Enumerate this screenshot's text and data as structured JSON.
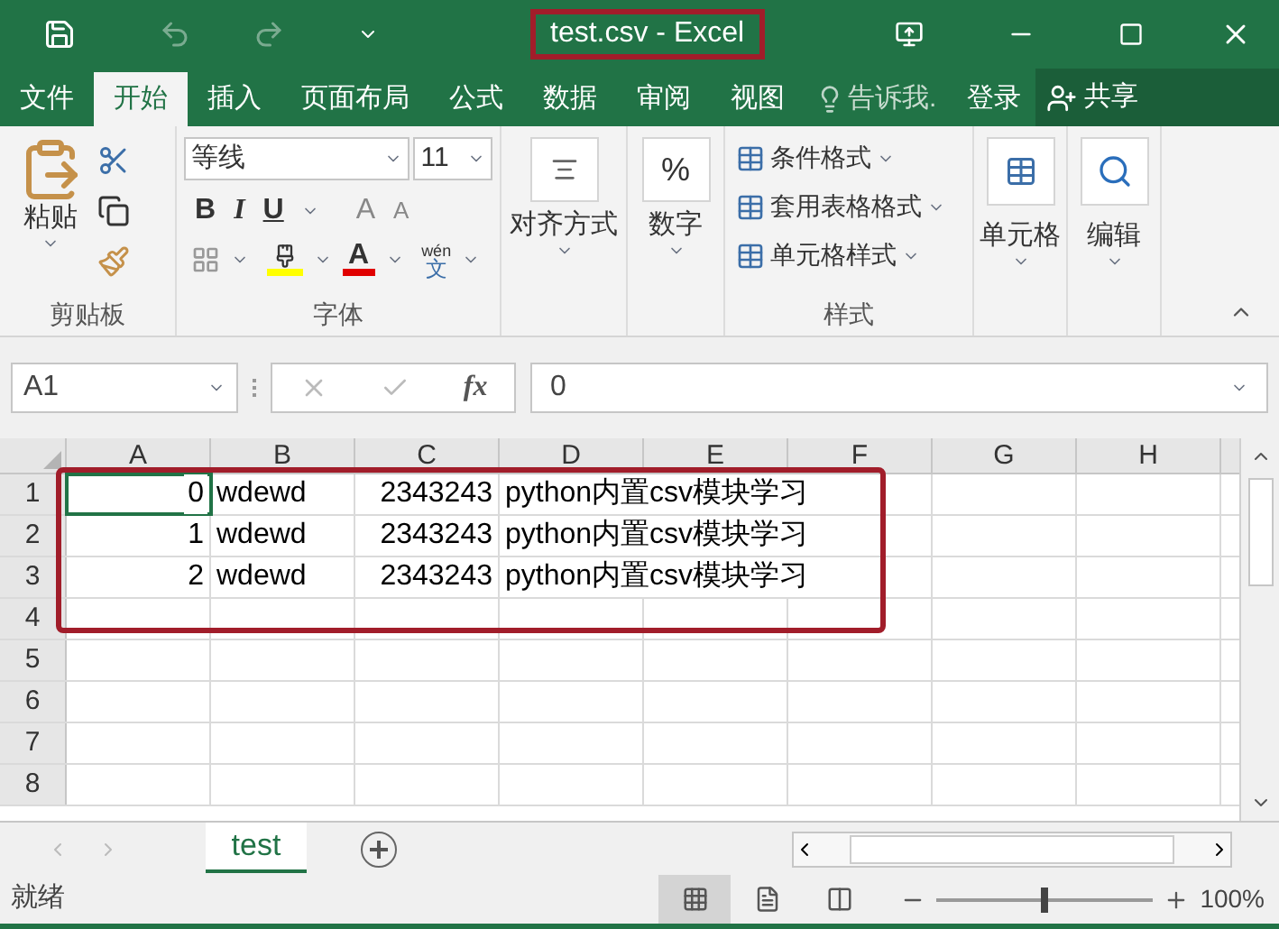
{
  "window": {
    "title": "test.csv - Excel"
  },
  "ribbon_tabs": [
    {
      "label": "文件",
      "selected": false
    },
    {
      "label": "开始",
      "selected": true
    },
    {
      "label": "插入",
      "selected": false
    },
    {
      "label": "页面布局",
      "selected": false
    },
    {
      "label": "公式",
      "selected": false
    },
    {
      "label": "数据",
      "selected": false
    },
    {
      "label": "审阅",
      "selected": false
    },
    {
      "label": "视图",
      "selected": false
    }
  ],
  "tell_me": {
    "placeholder": "告诉我."
  },
  "login": "登录",
  "share": "共享",
  "clipboard": {
    "paste": "粘贴",
    "group_label": "剪贴板"
  },
  "font": {
    "font_name": "等线",
    "font_size": "11",
    "bold": "B",
    "italic": "I",
    "underline": "U",
    "grow_font": "A",
    "shrink_font": "A",
    "font_color": "A",
    "phonetic": "wén",
    "phonetic_char": "文",
    "group_label": "字体"
  },
  "alignment": {
    "label": "对齐方式"
  },
  "number": {
    "symbol": "%",
    "label": "数字"
  },
  "styles": {
    "items": [
      "条件格式",
      "套用表格格式",
      "单元格样式"
    ],
    "group_label": "样式"
  },
  "cells": {
    "label": "单元格"
  },
  "editing": {
    "label": "编辑"
  },
  "name_box": {
    "value": "A1"
  },
  "formula_bar": {
    "fx": "fx",
    "value": "0"
  },
  "columns": [
    "A",
    "B",
    "C",
    "D",
    "E",
    "F",
    "G",
    "H"
  ],
  "row_numbers": [
    "1",
    "2",
    "3",
    "4",
    "5",
    "6",
    "7",
    "8"
  ],
  "rows": [
    {
      "cells": [
        {
          "value": "0",
          "kind": "number",
          "selected": true
        },
        {
          "value": "wdewd",
          "kind": "text",
          "selected": false
        },
        {
          "value": "2343243",
          "kind": "number",
          "selected": false
        },
        {
          "value": "python内置csv模块学习",
          "kind": "text",
          "selected": false
        }
      ]
    },
    {
      "cells": [
        {
          "value": "1",
          "kind": "number",
          "selected": false
        },
        {
          "value": "wdewd",
          "kind": "text",
          "selected": false
        },
        {
          "value": "2343243",
          "kind": "number",
          "selected": false
        },
        {
          "value": "python内置csv模块学习",
          "kind": "text",
          "selected": false
        }
      ]
    },
    {
      "cells": [
        {
          "value": "2",
          "kind": "number",
          "selected": false
        },
        {
          "value": "wdewd",
          "kind": "text",
          "selected": false
        },
        {
          "value": "2343243",
          "kind": "number",
          "selected": false
        },
        {
          "value": "python内置csv模块学习",
          "kind": "text",
          "selected": false
        }
      ]
    }
  ],
  "sheet_tabs": [
    {
      "label": "test",
      "selected": true
    }
  ],
  "status_bar": {
    "status": "就绪",
    "views": [
      {
        "kind": "normal",
        "selected": true
      },
      {
        "kind": "page_layout",
        "selected": false
      },
      {
        "kind": "page_break",
        "selected": false
      }
    ],
    "zoom": {
      "level": 0.5,
      "reading": "100%"
    }
  }
}
